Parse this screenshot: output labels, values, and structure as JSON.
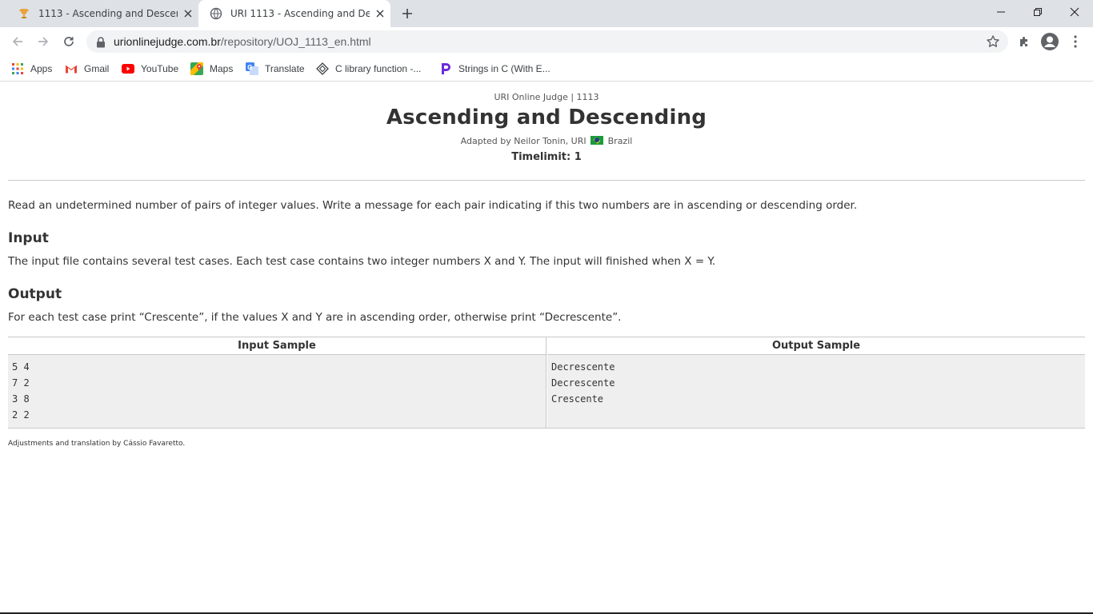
{
  "browser": {
    "tabs": [
      {
        "title": "1113 - Ascending and Descending",
        "active": false,
        "icon": "trophy-icon"
      },
      {
        "title": "URI 1113 - Ascending and Descending",
        "active": true,
        "icon": "globe-icon"
      }
    ],
    "url": {
      "domain": "urionlinejudge.com.br",
      "path": "/repository/UOJ_1113_en.html"
    },
    "bookmarks": [
      {
        "label": "Apps",
        "icon": "apps-grid-icon"
      },
      {
        "label": "Gmail",
        "icon": "gmail-icon"
      },
      {
        "label": "YouTube",
        "icon": "youtube-icon"
      },
      {
        "label": "Maps",
        "icon": "maps-icon"
      },
      {
        "label": "Translate",
        "icon": "translate-icon"
      },
      {
        "label": "C library function -...",
        "icon": "diamond-icon"
      },
      {
        "label": "Strings in C (With E...",
        "icon": "programiz-icon"
      }
    ],
    "colors": {
      "tabstrip": "#dee1e6",
      "omnibox": "#f1f3f4",
      "sample_bg": "#efefef"
    }
  },
  "problem": {
    "header_line": "URI Online Judge | 1113",
    "title": "Ascending and Descending",
    "adapted_by": "Adapted by Neilor Tonin, URI",
    "country": "Brazil",
    "timelimit": "Timelimit: 1",
    "description": "Read an undetermined number of pairs of integer values. Write a message for each pair indicating if this two numbers are in ascending or descending order.",
    "input_heading": "Input",
    "input_text": "The input file contains several test cases. Each test case contains two integer numbers X and Y. The input will finished when X = Y.",
    "output_heading": "Output",
    "output_text": "For each test case print “Crescente”, if the values X and Y are in ascending order, otherwise print “Decrescente”.",
    "input_sample_heading": "Input Sample",
    "output_sample_heading": "Output Sample",
    "input_sample": [
      "5 4",
      "7 2",
      "3 8",
      "2 2"
    ],
    "output_sample": [
      "Decrescente",
      "Decrescente",
      "Crescente"
    ],
    "footnote": "Adjustments and translation by Cássio Favaretto."
  }
}
